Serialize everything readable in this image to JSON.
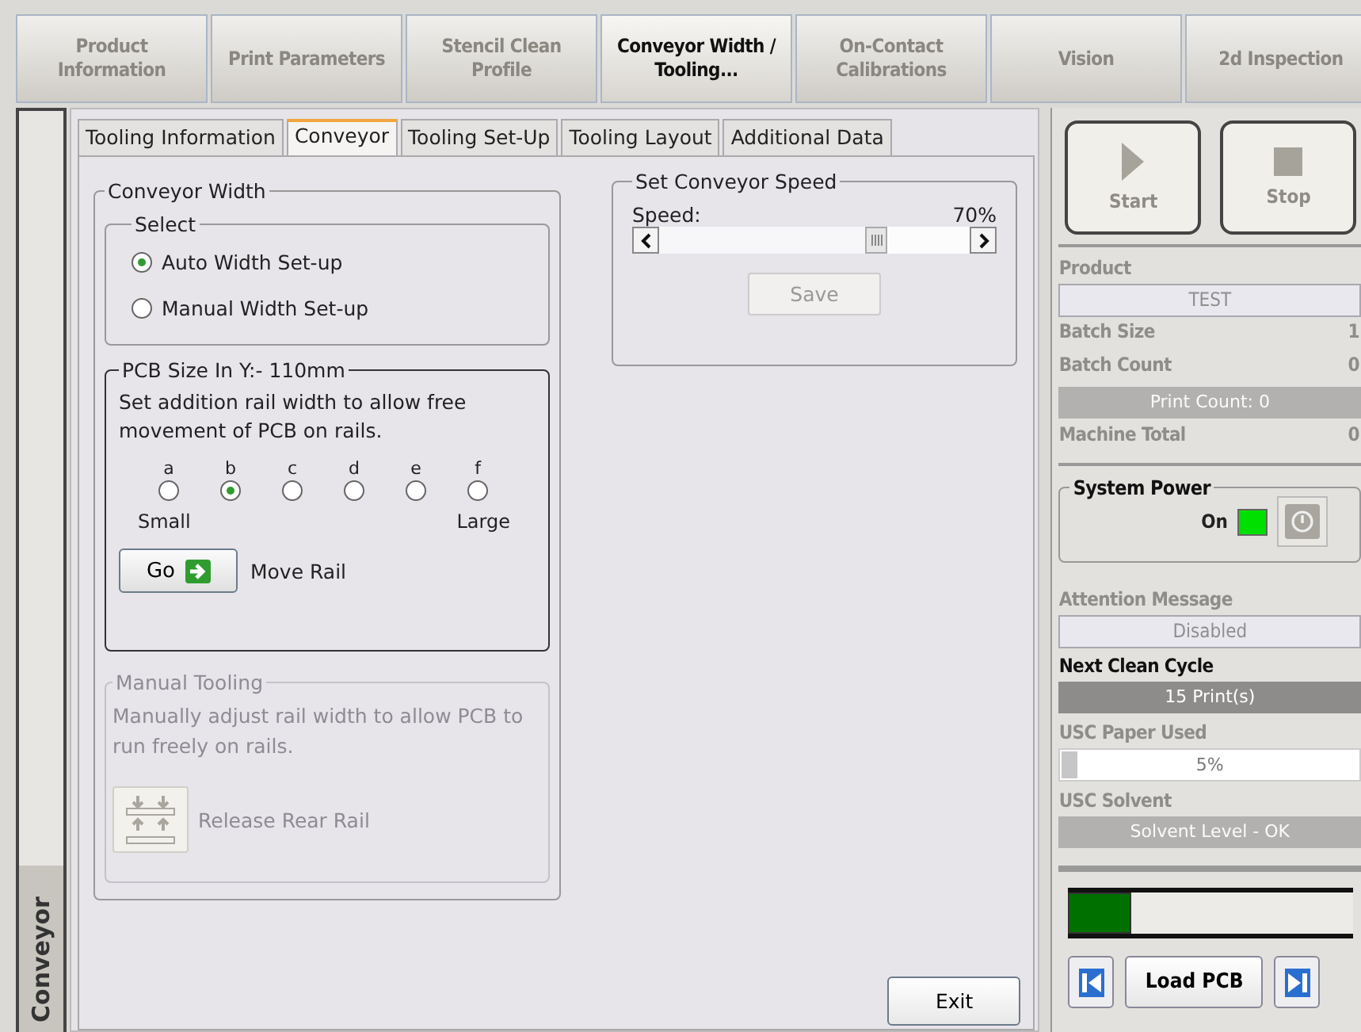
{
  "top_tabs": [
    {
      "label": "Product Information",
      "selected": false
    },
    {
      "label": "Print Parameters",
      "selected": false
    },
    {
      "label": "Stencil Clean Profile",
      "selected": false
    },
    {
      "label": "Conveyor Width / Tooling...",
      "selected": true
    },
    {
      "label": "On-Contact Calibrations",
      "selected": false
    },
    {
      "label": "Vision",
      "selected": false
    },
    {
      "label": "2d Inspection",
      "selected": false
    }
  ],
  "side_tab": {
    "label": "Conveyor"
  },
  "sub_tabs": [
    {
      "label": "Tooling Information",
      "selected": false
    },
    {
      "label": "Conveyor",
      "selected": true
    },
    {
      "label": "Tooling Set-Up",
      "selected": false
    },
    {
      "label": "Tooling Layout",
      "selected": false
    },
    {
      "label": "Additional Data",
      "selected": false
    }
  ],
  "conveyor_width": {
    "title": "Conveyor Width",
    "select": {
      "title": "Select",
      "options": [
        {
          "label": "Auto Width Set-up",
          "selected": true
        },
        {
          "label": "Manual Width Set-up",
          "selected": false
        }
      ]
    },
    "pcb_size": {
      "title": "PCB Size In Y:- 110mm",
      "description": "Set addition rail width to allow free movement of PCB on rails.",
      "positions": [
        {
          "label": "a",
          "selected": false
        },
        {
          "label": "b",
          "selected": true
        },
        {
          "label": "c",
          "selected": false
        },
        {
          "label": "d",
          "selected": false
        },
        {
          "label": "e",
          "selected": false
        },
        {
          "label": "f",
          "selected": false
        }
      ],
      "min_label": "Small",
      "max_label": "Large",
      "go_button": "Go",
      "go_caption": "Move Rail"
    },
    "manual_tooling": {
      "title": "Manual Tooling",
      "description": "Manually adjust rail width to allow PCB to run freely on rails.",
      "button": "Release Rear Rail",
      "disabled": true
    }
  },
  "conveyor_speed": {
    "title": "Set Conveyor Speed",
    "label": "Speed:",
    "reading": "70%",
    "level": 0.7,
    "save_button": {
      "label": "Save",
      "disabled": true
    }
  },
  "exit_button": "Exit",
  "side_panel": {
    "start": {
      "label": "Start",
      "disabled": true
    },
    "stop": {
      "label": "Stop",
      "disabled": true
    },
    "status": [
      {
        "kind": "field",
        "label": "Product",
        "value": "TEST",
        "disabled": true
      },
      {
        "kind": "stat",
        "label": "Batch Size",
        "value": "1",
        "disabled": true
      },
      {
        "kind": "stat",
        "label": "Batch Count",
        "value": "0",
        "disabled": true
      },
      {
        "kind": "bar",
        "value": "Print Count: 0",
        "disabled": true
      },
      {
        "kind": "stat",
        "label": "Machine Total",
        "value": "0",
        "disabled": true
      }
    ],
    "system_power": {
      "title": "System Power",
      "state": "On",
      "on": true
    },
    "messages": [
      {
        "kind": "field",
        "label": "Attention Message",
        "value": "Disabled",
        "disabled": true
      },
      {
        "kind": "bar",
        "label": "Next Clean Cycle",
        "value": "15 Print(s)",
        "disabled": false
      },
      {
        "kind": "meter",
        "label": "USC Paper Used",
        "value": "5%",
        "level": 0.05,
        "disabled": true
      },
      {
        "kind": "bar",
        "label": "USC Solvent",
        "value": "Solvent Level - OK",
        "disabled": true
      }
    ],
    "load_pcb": "Load PCB"
  }
}
